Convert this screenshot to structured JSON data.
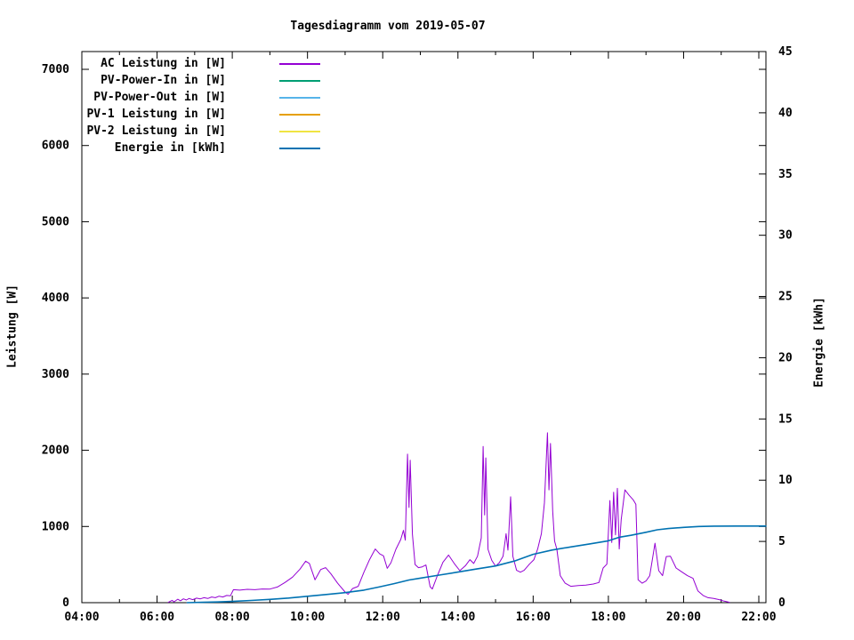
{
  "title": "Tagesdiagramm vom 2019-05-07",
  "axes": {
    "x": {
      "min_hour": 4,
      "max_hour": 22,
      "major_ticks": [
        {
          "hour": 4,
          "label": "04:00"
        },
        {
          "hour": 6,
          "label": "06:00"
        },
        {
          "hour": 8,
          "label": "08:00"
        },
        {
          "hour": 10,
          "label": "10:00"
        },
        {
          "hour": 12,
          "label": "12:00"
        },
        {
          "hour": 14,
          "label": "14:00"
        },
        {
          "hour": 16,
          "label": "16:00"
        },
        {
          "hour": 18,
          "label": "18:00"
        },
        {
          "hour": 20,
          "label": "20:00"
        },
        {
          "hour": 22,
          "label": "22:00"
        }
      ],
      "minor_tick_hours": [
        5,
        7,
        9,
        11,
        13,
        15,
        17,
        19,
        21
      ]
    },
    "y_left": {
      "label": "Leistung [W]",
      "min": 0,
      "max": 7000,
      "ticks": [
        0,
        1000,
        2000,
        3000,
        4000,
        5000,
        6000,
        7000
      ]
    },
    "y_right": {
      "label": "Energie [kWh]",
      "min": 0,
      "max": 45,
      "ticks": [
        0,
        5,
        10,
        15,
        20,
        25,
        30,
        35,
        40,
        45
      ]
    }
  },
  "legend": [
    {
      "label": "AC Leistung in [W]",
      "color": "#9400d3"
    },
    {
      "label": "PV-Power-In in [W]",
      "color": "#009e73"
    },
    {
      "label": "PV-Power-Out in [W]",
      "color": "#56b4e9"
    },
    {
      "label": "PV-1 Leistung in [W]",
      "color": "#e69f00"
    },
    {
      "label": "PV-2 Leistung in [W]",
      "color": "#f0e442"
    },
    {
      "label": "Energie in [kWh]",
      "color": "#0072b2"
    }
  ],
  "chart_data": {
    "type": "line",
    "title": "Tagesdiagramm vom 2019-05-07",
    "xlabel": "",
    "ylabel_left": "Leistung [W]",
    "ylabel_right": "Energie [kWh]",
    "x_range_hours": [
      4,
      22
    ],
    "ylim_left": [
      0,
      7000
    ],
    "ylim_right": [
      0,
      45
    ],
    "grid": false,
    "legend_position": "top-left-inside",
    "series": [
      {
        "name": "AC Leistung in [W]",
        "axis": "left",
        "color": "#9400d3",
        "width": 1,
        "x": [
          6.3,
          6.4,
          6.45,
          6.55,
          6.62,
          6.7,
          6.78,
          6.85,
          6.95,
          7.05,
          7.15,
          7.25,
          7.35,
          7.45,
          7.55,
          7.65,
          7.75,
          7.85,
          7.95,
          8.03,
          8.2,
          8.4,
          8.6,
          8.8,
          9.0,
          9.2,
          9.4,
          9.6,
          9.8,
          9.95,
          10.05,
          10.2,
          10.35,
          10.48,
          10.62,
          10.8,
          11.0,
          11.08,
          11.2,
          11.35,
          11.5,
          11.65,
          11.8,
          11.92,
          12.02,
          12.12,
          12.22,
          12.35,
          12.48,
          12.55,
          12.6,
          12.66,
          12.7,
          12.73,
          12.79,
          12.86,
          12.95,
          13.05,
          13.15,
          13.26,
          13.32,
          13.45,
          13.6,
          13.75,
          13.9,
          14.05,
          14.2,
          14.32,
          14.42,
          14.52,
          14.62,
          14.67,
          14.71,
          14.74,
          14.8,
          14.9,
          15.0,
          15.1,
          15.2,
          15.28,
          15.33,
          15.4,
          15.46,
          15.56,
          15.66,
          15.76,
          15.9,
          16.02,
          16.12,
          16.22,
          16.3,
          16.38,
          16.42,
          16.46,
          16.52,
          16.57,
          16.63,
          16.72,
          16.85,
          17.0,
          17.2,
          17.4,
          17.6,
          17.75,
          17.86,
          17.96,
          18.04,
          18.09,
          18.14,
          18.19,
          18.24,
          18.29,
          18.34,
          18.44,
          18.55,
          18.66,
          18.73,
          18.79,
          18.9,
          19.0,
          19.1,
          19.24,
          19.34,
          19.44,
          19.54,
          19.65,
          19.8,
          19.95,
          20.1,
          20.25,
          20.38,
          20.52,
          20.65,
          20.8,
          20.95,
          21.08,
          21.22
        ],
        "y": [
          5,
          30,
          10,
          45,
          25,
          50,
          35,
          55,
          40,
          60,
          50,
          65,
          55,
          75,
          65,
          85,
          75,
          95,
          90,
          170,
          165,
          175,
          170,
          180,
          178,
          205,
          265,
          335,
          440,
          545,
          515,
          300,
          435,
          460,
          380,
          255,
          140,
          110,
          185,
          215,
          400,
          565,
          705,
          640,
          615,
          450,
          525,
          700,
          830,
          950,
          820,
          1950,
          1250,
          1870,
          900,
          500,
          460,
          470,
          495,
          210,
          180,
          350,
          530,
          625,
          515,
          420,
          485,
          565,
          515,
          610,
          850,
          2050,
          1150,
          1900,
          700,
          555,
          480,
          525,
          610,
          905,
          690,
          1390,
          610,
          425,
          400,
          425,
          505,
          565,
          705,
          905,
          1310,
          2230,
          1480,
          2090,
          1200,
          810,
          700,
          355,
          255,
          215,
          225,
          230,
          245,
          265,
          455,
          505,
          1340,
          790,
          1450,
          890,
          1500,
          705,
          1090,
          1480,
          1410,
          1350,
          1290,
          300,
          255,
          285,
          355,
          780,
          420,
          355,
          605,
          610,
          455,
          405,
          355,
          320,
          155,
          95,
          65,
          55,
          40,
          20,
          5
        ]
      },
      {
        "name": "PV-Power-In in [W]",
        "axis": "left",
        "color": "#009e73",
        "width": 1,
        "x": [],
        "y": []
      },
      {
        "name": "PV-Power-Out in [W]",
        "axis": "left",
        "color": "#56b4e9",
        "width": 1,
        "x": [],
        "y": []
      },
      {
        "name": "PV-1 Leistung in [W]",
        "axis": "left",
        "color": "#e69f00",
        "width": 1,
        "x": [],
        "y": []
      },
      {
        "name": "PV-2 Leistung in [W]",
        "axis": "left",
        "color": "#f0e442",
        "width": 1,
        "x": [],
        "y": []
      },
      {
        "name": "Energie in [kWh]",
        "axis": "right",
        "color": "#0072b2",
        "width": 1.6,
        "x": [
          6.8,
          7.2,
          7.6,
          8.0,
          8.5,
          9.0,
          9.5,
          10.0,
          10.5,
          11.0,
          11.5,
          11.9,
          12.3,
          12.7,
          13.0,
          13.5,
          14.0,
          14.5,
          15.0,
          15.5,
          16.0,
          16.5,
          17.0,
          17.5,
          18.0,
          18.3,
          18.6,
          19.0,
          19.3,
          19.6,
          20.0,
          20.4,
          20.8,
          21.4,
          22.19
        ],
        "y": [
          0,
          0.03,
          0.06,
          0.1,
          0.18,
          0.27,
          0.38,
          0.52,
          0.67,
          0.82,
          1.02,
          1.28,
          1.55,
          1.85,
          2.0,
          2.25,
          2.5,
          2.75,
          3.0,
          3.4,
          3.95,
          4.3,
          4.55,
          4.8,
          5.05,
          5.35,
          5.5,
          5.75,
          5.95,
          6.05,
          6.15,
          6.22,
          6.25,
          6.26,
          6.26
        ]
      }
    ]
  }
}
